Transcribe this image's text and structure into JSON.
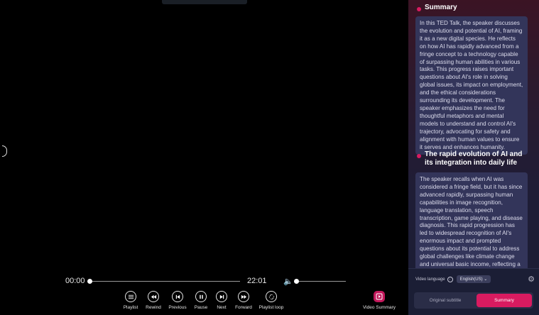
{
  "player": {
    "current_time": "00:00",
    "duration": "22:01",
    "progress": 0,
    "volume": 0,
    "controls": [
      {
        "label": "Playlist",
        "icon": "playlist-icon"
      },
      {
        "label": "Rewind",
        "icon": "rewind-icon"
      },
      {
        "label": "Previous",
        "icon": "previous-icon"
      },
      {
        "label": "Pause",
        "icon": "pause-icon"
      },
      {
        "label": "Next",
        "icon": "next-icon"
      },
      {
        "label": "Forward",
        "icon": "forward-icon"
      },
      {
        "label": "Playlist loop",
        "icon": "loop-icon"
      }
    ],
    "video_summary_label": "Video Summary"
  },
  "panel": {
    "sections": [
      {
        "title": "Summary",
        "body": "In this TED Talk, the speaker discusses the evolution and potential of AI, framing it as a new digital species. He reflects on how AI has rapidly advanced from a fringe concept to a technology capable of surpassing human abilities in various tasks. This progress raises important questions about AI's role in solving global issues, its impact on employment, and the ethical considerations surrounding its development. The speaker emphasizes the need for thoughtful metaphors and mental models to understand and control AI's trajectory, advocating for safety and alignment with human values to ensure it serves and enhances humanity."
      },
      {
        "title": "The rapid evolution of AI and its integration into daily life",
        "body": "The speaker recalls when AI was considered a fringe field, but it has since advanced rapidly, surpassing human capabilities in image recognition, language translation, speech transcription, game playing, and disease diagnosis. This rapid progression has led to widespread recognition of AI's enormous impact and prompted questions about its potential to address global challenges like climate change and universal basic income, reflecting a significant shift in public"
      }
    ],
    "footer": {
      "language_label": "Video language",
      "language_value": "English(US)",
      "tab_original": "Original subtitle",
      "tab_summary": "Summary",
      "active_tab": "Summary"
    }
  },
  "colors": {
    "accent": "#d81b60",
    "panel_card": "#33355a"
  }
}
